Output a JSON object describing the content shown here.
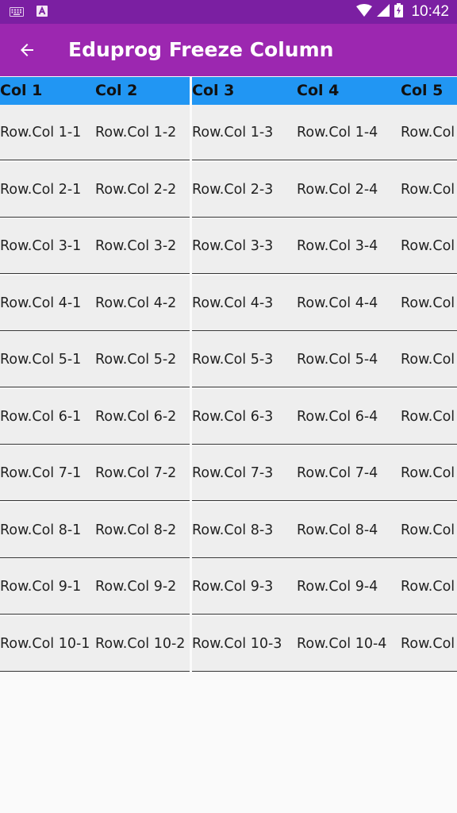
{
  "status_bar": {
    "time": "10:42",
    "left_icons": [
      "keyboard-icon",
      "a-icon"
    ],
    "right_icons": [
      "wifi-icon",
      "signal-icon",
      "battery-icon"
    ]
  },
  "app_bar": {
    "title": "Eduprog Freeze Column",
    "back_icon": "arrow-left-icon",
    "background": "#9c27b0",
    "status_background": "#7b1fa2"
  },
  "table": {
    "header_color": "#2196f3",
    "frozen_columns": [
      "Col 1",
      "Col 2"
    ],
    "scroll_columns": [
      "Col 3",
      "Col 4",
      "Col 5"
    ],
    "rows": [
      [
        "Row.Col 1-1",
        "Row.Col 1-2",
        "Row.Col 1-3",
        "Row.Col 1-4",
        "Row.Col"
      ],
      [
        "Row.Col 2-1",
        "Row.Col 2-2",
        "Row.Col 2-3",
        "Row.Col 2-4",
        "Row.Col"
      ],
      [
        "Row.Col 3-1",
        "Row.Col 3-2",
        "Row.Col 3-3",
        "Row.Col 3-4",
        "Row.Col"
      ],
      [
        "Row.Col 4-1",
        "Row.Col 4-2",
        "Row.Col 4-3",
        "Row.Col 4-4",
        "Row.Col"
      ],
      [
        "Row.Col 5-1",
        "Row.Col 5-2",
        "Row.Col 5-3",
        "Row.Col 5-4",
        "Row.Col"
      ],
      [
        "Row.Col 6-1",
        "Row.Col 6-2",
        "Row.Col 6-3",
        "Row.Col 6-4",
        "Row.Col"
      ],
      [
        "Row.Col 7-1",
        "Row.Col 7-2",
        "Row.Col 7-3",
        "Row.Col 7-4",
        "Row.Col"
      ],
      [
        "Row.Col 8-1",
        "Row.Col 8-2",
        "Row.Col 8-3",
        "Row.Col 8-4",
        "Row.Col"
      ],
      [
        "Row.Col 9-1",
        "Row.Col 9-2",
        "Row.Col 9-3",
        "Row.Col 9-4",
        "Row.Col"
      ],
      [
        "Row.Col 10-1",
        "Row.Col 10-2",
        "Row.Col 10-3",
        "Row.Col 10-4",
        "Row.Col"
      ]
    ]
  }
}
